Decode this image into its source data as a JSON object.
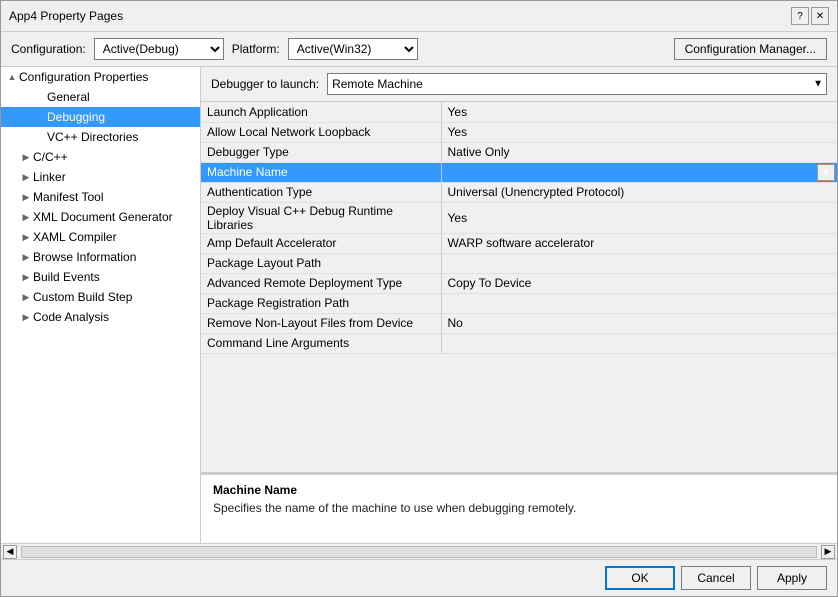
{
  "dialog": {
    "title": "App4 Property Pages",
    "title_btn_help": "?",
    "title_btn_close": "✕"
  },
  "config_bar": {
    "config_label": "Configuration:",
    "config_value": "Active(Debug)",
    "platform_label": "Platform:",
    "platform_value": "Active(Win32)",
    "manager_btn": "Configuration Manager..."
  },
  "left_panel": {
    "items": [
      {
        "id": "config-props",
        "label": "Configuration Properties",
        "level": 0,
        "toggle": "▲",
        "selected": false
      },
      {
        "id": "general",
        "label": "General",
        "level": 1,
        "toggle": "",
        "selected": false
      },
      {
        "id": "debugging",
        "label": "Debugging",
        "level": 1,
        "toggle": "",
        "selected": true
      },
      {
        "id": "vc-dirs",
        "label": "VC++ Directories",
        "level": 1,
        "toggle": "",
        "selected": false
      },
      {
        "id": "c-cpp",
        "label": "C/C++",
        "level": 0,
        "toggle": "▶",
        "selected": false
      },
      {
        "id": "linker",
        "label": "Linker",
        "level": 0,
        "toggle": "▶",
        "selected": false
      },
      {
        "id": "manifest-tool",
        "label": "Manifest Tool",
        "level": 0,
        "toggle": "▶",
        "selected": false
      },
      {
        "id": "xml-doc",
        "label": "XML Document Generator",
        "level": 0,
        "toggle": "▶",
        "selected": false
      },
      {
        "id": "xaml-compiler",
        "label": "XAML Compiler",
        "level": 0,
        "toggle": "▶",
        "selected": false
      },
      {
        "id": "browse-info",
        "label": "Browse Information",
        "level": 0,
        "toggle": "▶",
        "selected": false
      },
      {
        "id": "build-events",
        "label": "Build Events",
        "level": 0,
        "toggle": "▶",
        "selected": false
      },
      {
        "id": "custom-build",
        "label": "Custom Build Step",
        "level": 0,
        "toggle": "▶",
        "selected": false
      },
      {
        "id": "code-analysis",
        "label": "Code Analysis",
        "level": 0,
        "toggle": "▶",
        "selected": false
      }
    ]
  },
  "right_panel": {
    "debugger_label": "Debugger to launch:",
    "debugger_value": "Remote Machine",
    "properties": [
      {
        "name": "Launch Application",
        "value": "Yes",
        "selected": false
      },
      {
        "name": "Allow Local Network Loopback",
        "value": "Yes",
        "selected": false
      },
      {
        "name": "Debugger Type",
        "value": "Native Only",
        "selected": false
      },
      {
        "name": "Machine Name",
        "value": "",
        "selected": true,
        "has_dropdown": true
      },
      {
        "name": "Authentication Type",
        "value": "Universal (Unencrypted Protocol)",
        "selected": false
      },
      {
        "name": "Deploy Visual C++ Debug Runtime Libraries",
        "value": "Yes",
        "selected": false
      },
      {
        "name": "Amp Default Accelerator",
        "value": "WARP software accelerator",
        "selected": false
      },
      {
        "name": "Package Layout Path",
        "value": "",
        "selected": false
      },
      {
        "name": "Advanced Remote Deployment Type",
        "value": "Copy To Device",
        "selected": false
      },
      {
        "name": "Package Registration Path",
        "value": "",
        "selected": false
      },
      {
        "name": "Remove Non-Layout Files from Device",
        "value": "No",
        "selected": false
      },
      {
        "name": "Command Line Arguments",
        "value": "",
        "selected": false
      }
    ]
  },
  "info_box": {
    "title": "Machine Name",
    "description": "Specifies the name of the machine to use when debugging remotely."
  },
  "bottom_bar": {
    "ok_label": "OK",
    "cancel_label": "Cancel",
    "apply_label": "Apply"
  }
}
